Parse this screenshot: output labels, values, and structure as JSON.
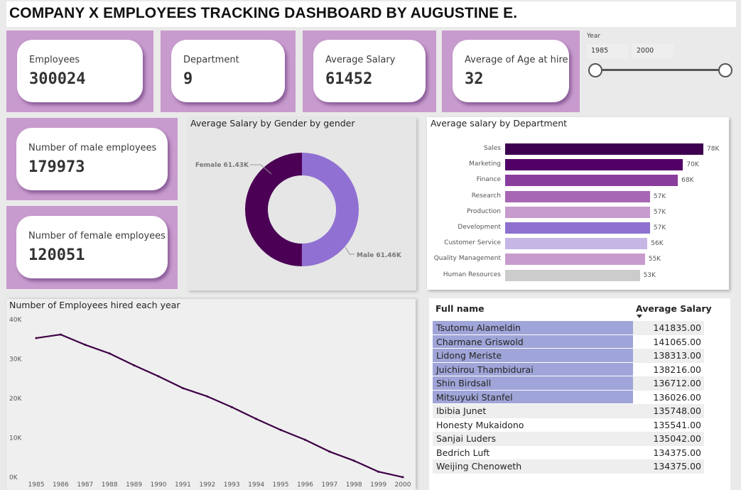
{
  "title": "COMPANY X EMPLOYEES TRACKING DASHBOARD BY AUGUSTINE E.",
  "kpis": {
    "employees": {
      "label": "Employees",
      "value": "300024"
    },
    "department": {
      "label": "Department",
      "value": "9"
    },
    "avg_salary": {
      "label": "Average Salary",
      "value": "61452"
    },
    "avg_age": {
      "label": "Average of Age at hire",
      "value": "32"
    },
    "male": {
      "label": "Number of male employees",
      "value": "179973"
    },
    "female": {
      "label": "Number of female employees",
      "value": "120051"
    }
  },
  "slicer": {
    "label": "Year",
    "start": "1985",
    "end": "2000"
  },
  "colors": {
    "tile": "#c79bcd",
    "dark_purple": "#4b0055",
    "mid_purple": "#8e71cf"
  },
  "gender_chart": {
    "title": "Average Salary by Gender by gender",
    "chart_data": {
      "type": "pie",
      "slices": [
        {
          "name": "Female",
          "value": 61.43,
          "label": "Female 61.43K",
          "color": "#4b0055"
        },
        {
          "name": "Male",
          "value": 61.46,
          "label": "Male 61.46K",
          "color": "#9070d2"
        }
      ]
    }
  },
  "dept_chart": {
    "title": "Average salary by Department",
    "chart_data": {
      "type": "bar",
      "categories": [
        "Sales",
        "Marketing",
        "Finance",
        "Research",
        "Production",
        "Development",
        "Customer Service",
        "Quality Management",
        "Human Resources"
      ],
      "values": [
        78,
        70,
        68,
        57,
        57,
        57,
        56,
        55,
        53
      ],
      "labels": [
        "78K",
        "70K",
        "68K",
        "57K",
        "57K",
        "57K",
        "56K",
        "55K",
        "53K"
      ],
      "colors": [
        "#3d0050",
        "#520066",
        "#8a3c9c",
        "#a867b4",
        "#c79bcd",
        "#8e71cf",
        "#c6b6e6",
        "#c79bcd",
        "#cccccc"
      ]
    }
  },
  "hires_chart": {
    "title": "Number of Employees hired each year",
    "chart_data": {
      "type": "line",
      "x": [
        "1985",
        "1986",
        "1987",
        "1988",
        "1989",
        "1990",
        "1991",
        "1992",
        "1993",
        "1994",
        "1995",
        "1996",
        "1997",
        "1998",
        "1999",
        "2000"
      ],
      "y": [
        35300,
        36200,
        33600,
        31400,
        28400,
        25600,
        22600,
        20500,
        17800,
        14800,
        12000,
        9500,
        6500,
        4200,
        1400,
        13
      ],
      "yticks": [
        "0K",
        "10K",
        "20K",
        "30K",
        "40K"
      ],
      "ylim": [
        0,
        40000
      ],
      "color": "#3d0045"
    }
  },
  "table": {
    "headers": {
      "name": "Full name",
      "salary": "Average Salary"
    },
    "rows": [
      {
        "name": "Tsutomu Alameldin",
        "salary": "141835.00",
        "highlight": true
      },
      {
        "name": "Charmane Griswold",
        "salary": "141065.00",
        "highlight": true
      },
      {
        "name": "Lidong Meriste",
        "salary": "138313.00",
        "highlight": true
      },
      {
        "name": "Juichirou Thambidurai",
        "salary": "138216.00",
        "highlight": true
      },
      {
        "name": "Shin Birdsall",
        "salary": "136712.00",
        "highlight": true
      },
      {
        "name": "Mitsuyuki Stanfel",
        "salary": "136026.00",
        "highlight": true
      },
      {
        "name": "Ibibia Junet",
        "salary": "135748.00",
        "highlight": false
      },
      {
        "name": "Honesty Mukaidono",
        "salary": "135541.00",
        "highlight": false
      },
      {
        "name": "Sanjai Luders",
        "salary": "135042.00",
        "highlight": false
      },
      {
        "name": "Bedrich Luft",
        "salary": "134375.00",
        "highlight": false
      },
      {
        "name": "Weijing Chenoweth",
        "salary": "134375.00",
        "highlight": false
      }
    ]
  }
}
